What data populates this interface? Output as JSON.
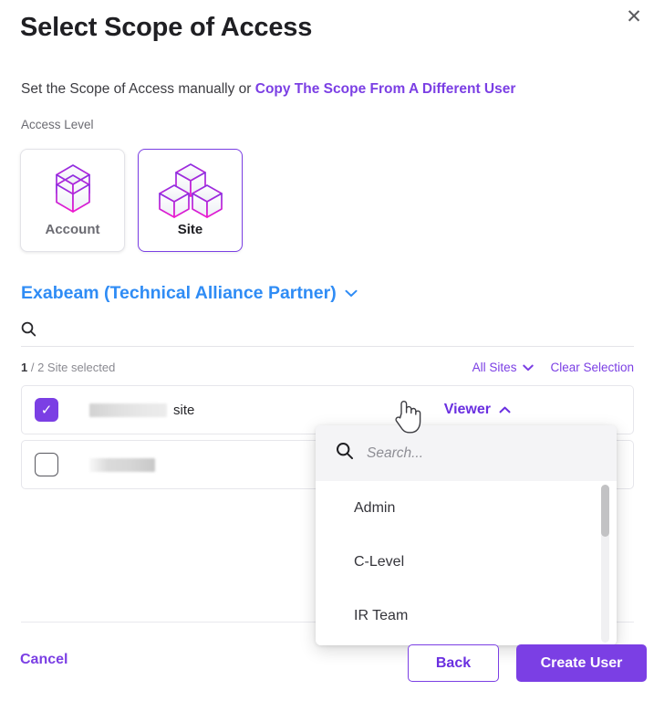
{
  "dialog": {
    "title": "Select Scope of Access",
    "close_label": "✕",
    "subtitle_text": "Set the Scope of Access manually or ",
    "subtitle_link": "Copy The Scope From A Different User"
  },
  "access_level": {
    "label": "Access Level",
    "options": [
      {
        "label": "Account",
        "icon": "account-cubes-icon",
        "selected": false
      },
      {
        "label": "Site",
        "icon": "site-cubes-icon",
        "selected": true
      }
    ]
  },
  "org_selector": {
    "name": "Exabeam (Technical Alliance Partner)",
    "chevron": "chevron-down-icon"
  },
  "site_search": {
    "value": "",
    "placeholder": "",
    "icon": "search-icon"
  },
  "selection_bar": {
    "count": "1",
    "count_suffix": "/ 2 Site selected",
    "filter_label": "All Sites",
    "clear_label": "Clear Selection"
  },
  "site_rows": [
    {
      "name_redacted": true,
      "name_suffix": "site",
      "checked": true,
      "role": "Viewer"
    },
    {
      "name_redacted": true,
      "name_suffix": "",
      "checked": false,
      "role": ""
    }
  ],
  "role_dropdown": {
    "search_placeholder": "Search...",
    "search_value": "",
    "search_icon": "search-icon",
    "items": [
      "Admin",
      "C-Level",
      "IR Team"
    ]
  },
  "footer": {
    "cancel_label": "Cancel",
    "back_label": "Back",
    "create_label": "Create User"
  },
  "colors": {
    "accent_purple": "#7b3fe4",
    "link_blue": "#2f8cf5",
    "magenta": "#e81ee8",
    "text_dark": "#1f1f23"
  }
}
